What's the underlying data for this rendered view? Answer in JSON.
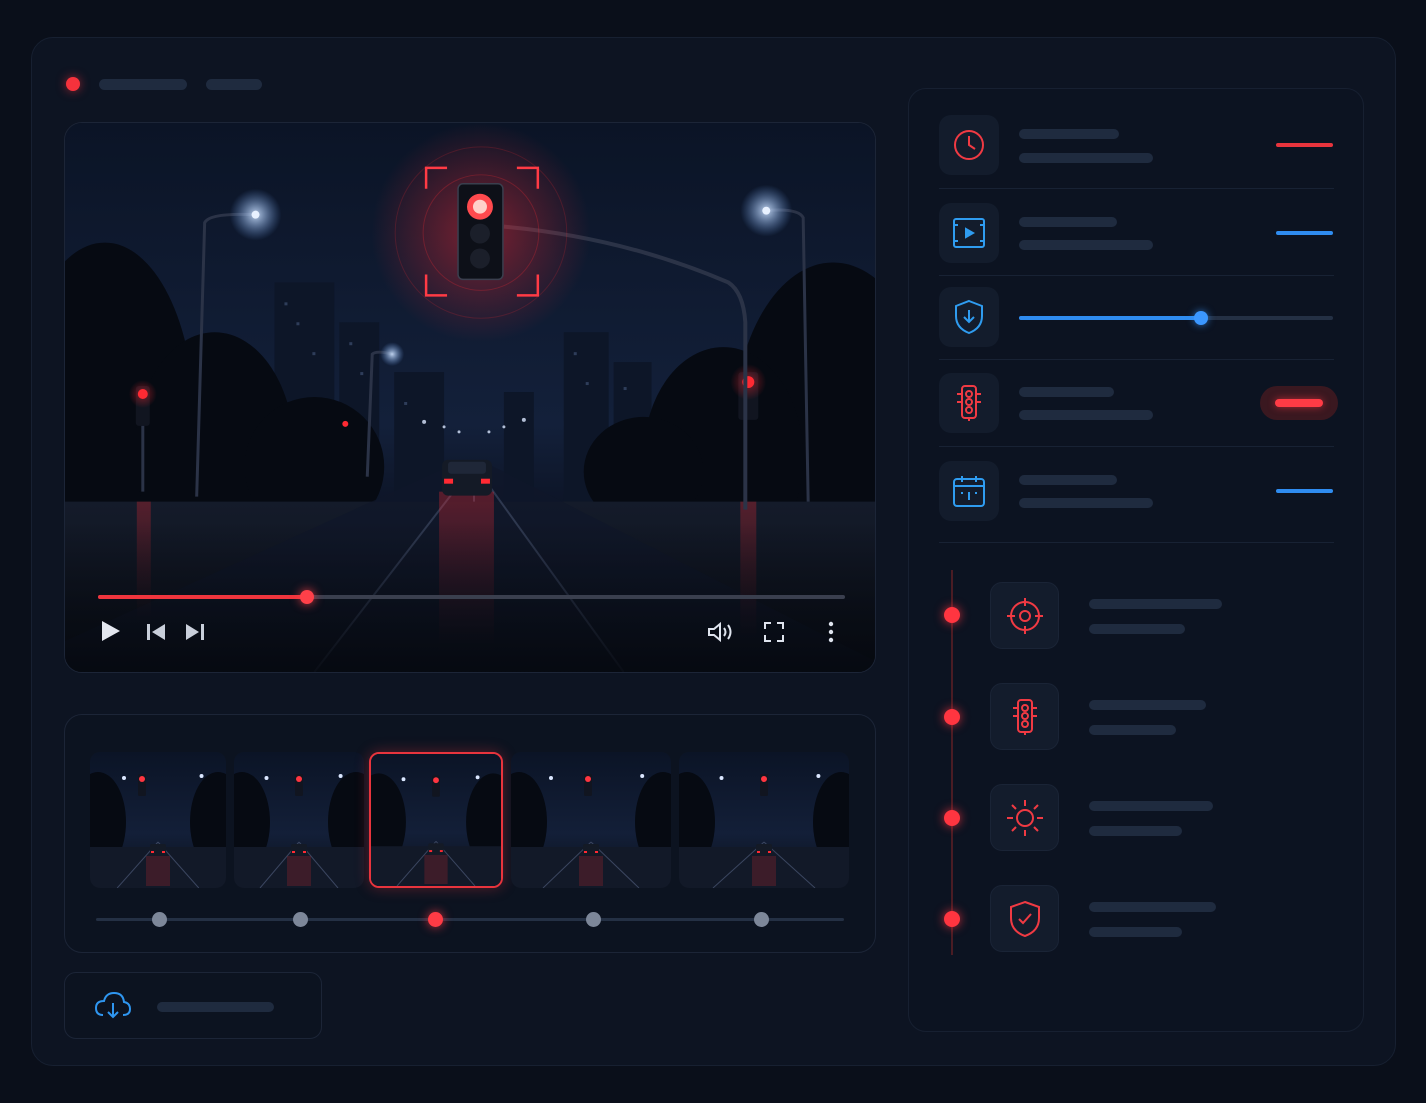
{
  "theme": {
    "accent_red": "#f5323c",
    "accent_blue": "#2f8cf0",
    "panel_bg": "#0c1321",
    "placeholder": "#1f2b3f"
  },
  "header": {
    "status_icon": "record-dot-icon"
  },
  "player": {
    "detection_target": "traffic-light",
    "progress": 0.28,
    "controls": [
      "play-icon",
      "skip-previous-icon",
      "skip-next-icon",
      "volume-icon",
      "fullscreen-icon",
      "more-vertical-icon"
    ]
  },
  "thumbnails": {
    "count": 5,
    "active_index": 2
  },
  "download": {
    "icon": "cloud-download-icon"
  },
  "properties": [
    {
      "icon": "clock-icon",
      "accent": "#e8343d",
      "control": "bar"
    },
    {
      "icon": "video-frame-icon",
      "accent": "#2f8cf0",
      "control": "bar"
    },
    {
      "icon": "shield-download-icon",
      "accent": "#2f8cf0",
      "control": "slider",
      "value": 0.58
    },
    {
      "icon": "traffic-light-icon",
      "accent": "#e8343d",
      "control": "toggle"
    },
    {
      "icon": "calendar-icon",
      "accent": "#2f8cf0",
      "control": "bar"
    }
  ],
  "events": [
    {
      "icon": "target-icon"
    },
    {
      "icon": "traffic-light-icon"
    },
    {
      "icon": "sun-icon"
    },
    {
      "icon": "shield-check-icon"
    }
  ]
}
